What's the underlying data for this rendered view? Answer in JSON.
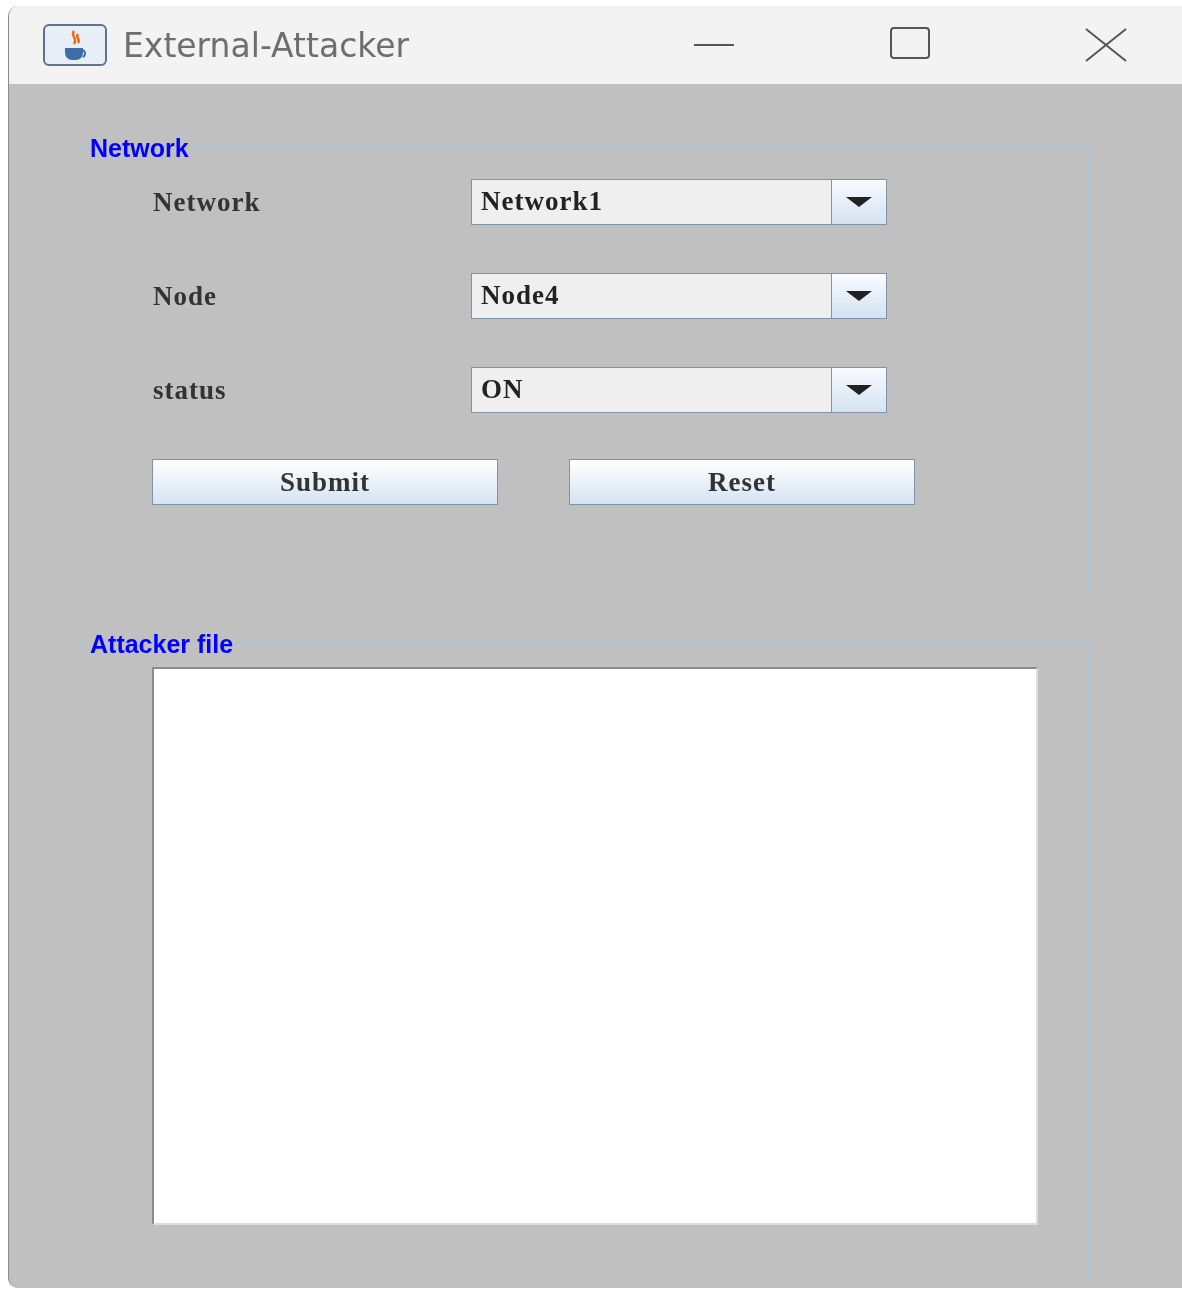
{
  "window": {
    "title": "External-Attacker"
  },
  "network_panel": {
    "legend": "Network",
    "fields": [
      {
        "label": "Network",
        "value": "Network1"
      },
      {
        "label": "Node",
        "value": "Node4"
      },
      {
        "label": "status",
        "value": "ON"
      }
    ],
    "buttons": [
      "Submit",
      "Reset"
    ]
  },
  "attacker_panel": {
    "legend": "Attacker file"
  }
}
